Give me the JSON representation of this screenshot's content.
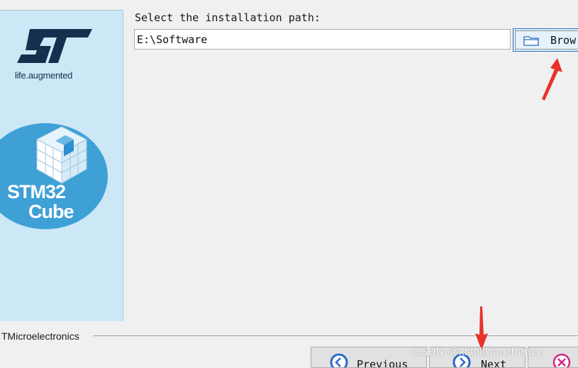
{
  "installer": {
    "path_label": "Select the installation path:",
    "path_value": "E:\\Software",
    "browse_label": "Brow",
    "vendor_text": "TMicroelectronics",
    "buttons": {
      "previous": "Previous",
      "next": "Next"
    }
  },
  "branding": {
    "tagline": "life.augmented",
    "product_line1": "STM32",
    "product_line2": "Cube"
  },
  "watermark": "CSDN @xiaolixiaochen12",
  "icons": {
    "browse": "folder-icon",
    "previous": "back-arrow-icon",
    "next": "forward-arrow-icon",
    "cancel": "cancel-icon",
    "annotation": "red-arrow-annotation"
  },
  "colors": {
    "sidebar": "#cce8f6",
    "cube_circle": "#3fa0d6",
    "st_logo": "#13304e",
    "annotation_arrow": "#e8322c",
    "button_focus_border": "#2a6ac8",
    "cancel_icon": "#d1288a"
  }
}
